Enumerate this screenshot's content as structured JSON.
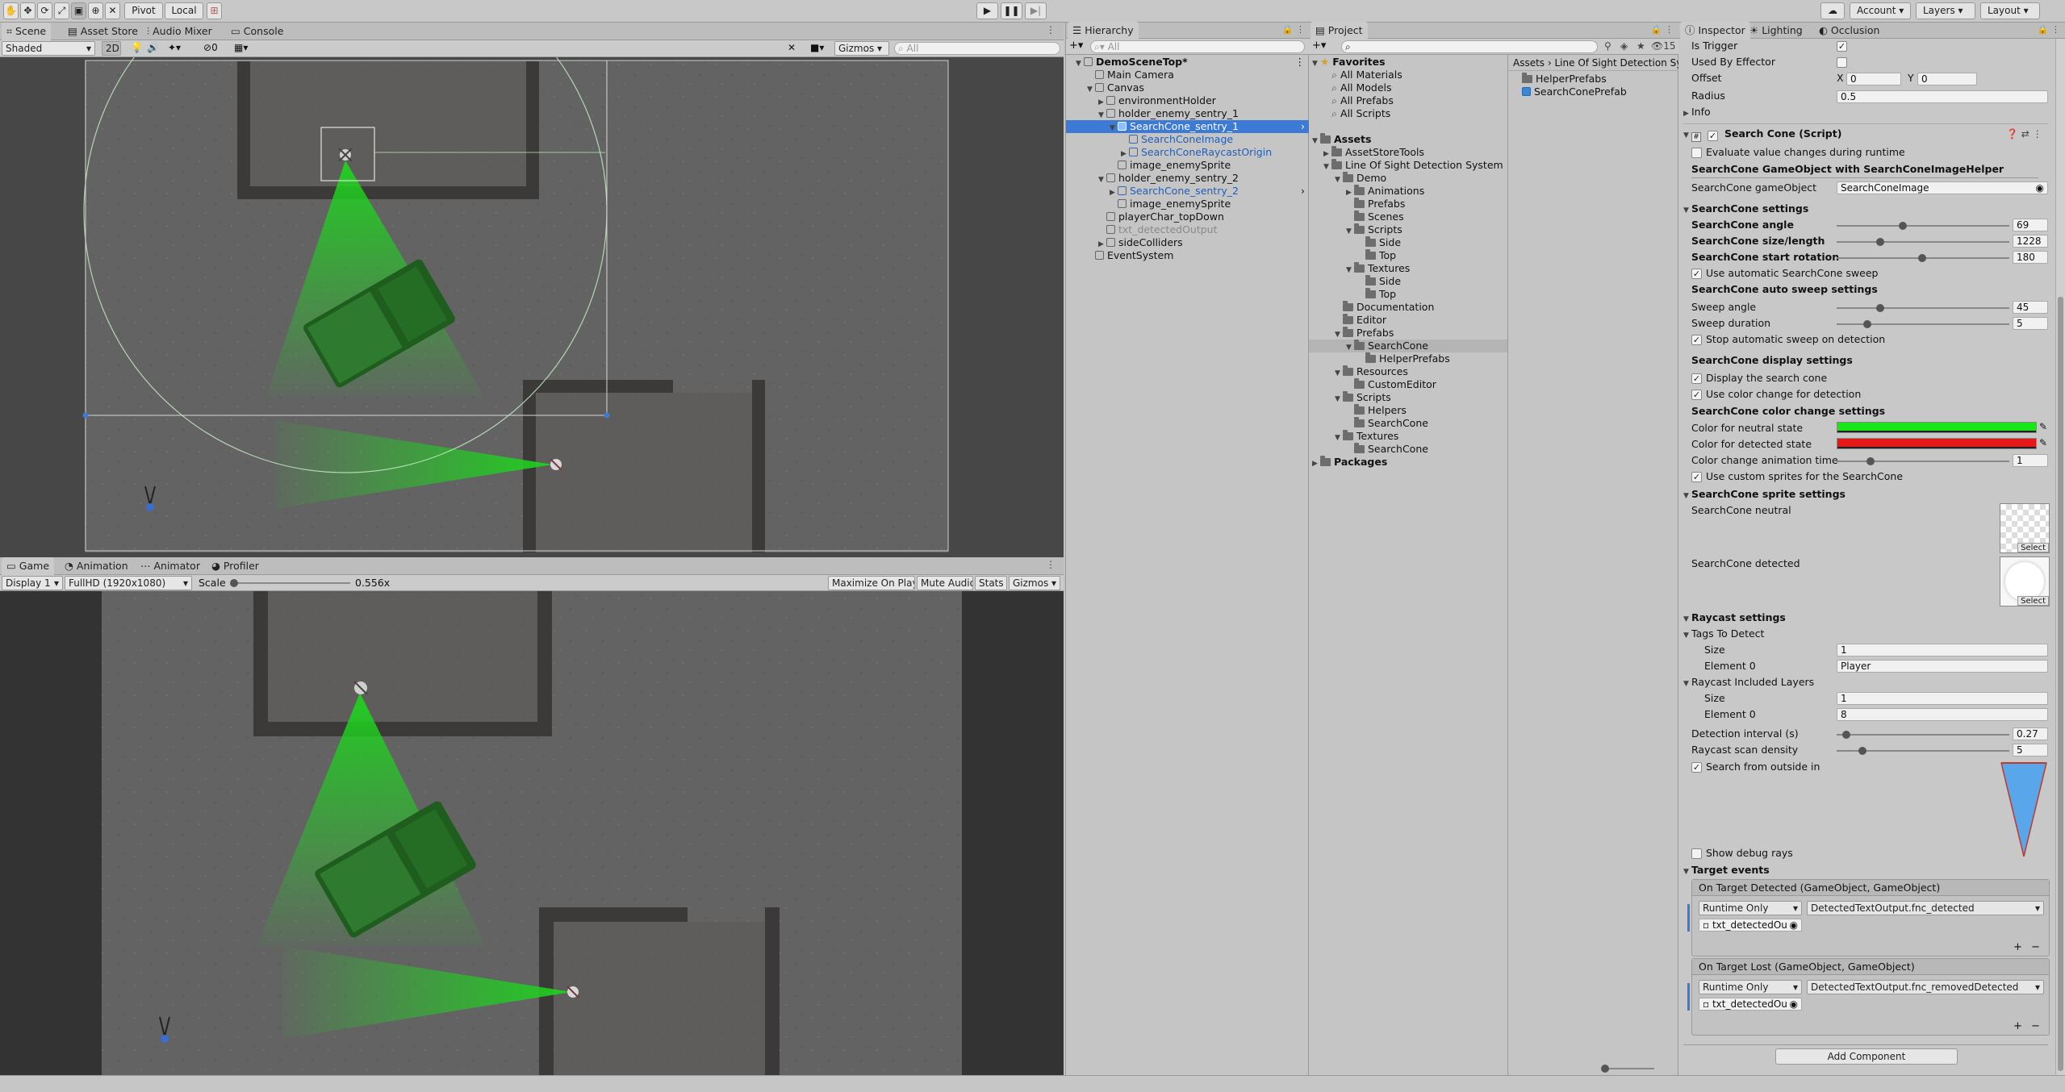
{
  "toolbar": {
    "pivot": "Pivot",
    "local": "Local",
    "account": "Account",
    "layers": "Layers",
    "layout": "Layout"
  },
  "scene": {
    "tabs": [
      "Scene",
      "Asset Store",
      "Audio Mixer",
      "Console"
    ],
    "shading": "Shaded",
    "mode2d": "2D",
    "hidden_count": "0",
    "gizmos": "Gizmos",
    "search_placeholder": "All"
  },
  "game": {
    "tabs": [
      "Game",
      "Animation",
      "Animator",
      "Profiler"
    ],
    "display": "Display 1",
    "resolution": "FullHD (1920x1080)",
    "scale_label": "Scale",
    "scale_value": "0.556x",
    "maximize": "Maximize On Play",
    "mute": "Mute Audio",
    "stats": "Stats",
    "gizmos": "Gizmos"
  },
  "hierarchy": {
    "title": "Hierarchy",
    "search_placeholder": "All",
    "items": [
      {
        "label": "DemoSceneTop*",
        "depth": 0,
        "fold": "open",
        "style": "scene"
      },
      {
        "label": "Main Camera",
        "depth": 1,
        "fold": "none",
        "style": "normal"
      },
      {
        "label": "Canvas",
        "depth": 1,
        "fold": "open",
        "style": "normal"
      },
      {
        "label": "environmentHolder",
        "depth": 2,
        "fold": "closed",
        "style": "normal"
      },
      {
        "label": "holder_enemy_sentry_1",
        "depth": 2,
        "fold": "open",
        "style": "normal"
      },
      {
        "label": "SearchCone_sentry_1",
        "depth": 3,
        "fold": "open",
        "style": "selected"
      },
      {
        "label": "SearchConeImage",
        "depth": 4,
        "fold": "none",
        "style": "prefab"
      },
      {
        "label": "SearchConeRaycastOrigin",
        "depth": 4,
        "fold": "closed",
        "style": "prefab"
      },
      {
        "label": "image_enemySprite",
        "depth": 3,
        "fold": "none",
        "style": "normal"
      },
      {
        "label": "holder_enemy_sentry_2",
        "depth": 2,
        "fold": "open",
        "style": "normal"
      },
      {
        "label": "SearchCone_sentry_2",
        "depth": 3,
        "fold": "closed",
        "style": "prefab"
      },
      {
        "label": "image_enemySprite",
        "depth": 3,
        "fold": "none",
        "style": "normal"
      },
      {
        "label": "playerChar_topDown",
        "depth": 2,
        "fold": "none",
        "style": "normal"
      },
      {
        "label": "txt_detectedOutput",
        "depth": 2,
        "fold": "none",
        "style": "disabled"
      },
      {
        "label": "sideColliders",
        "depth": 2,
        "fold": "closed",
        "style": "normal"
      },
      {
        "label": "EventSystem",
        "depth": 1,
        "fold": "none",
        "style": "normal"
      }
    ]
  },
  "project": {
    "title": "Project",
    "hidden_count": "15",
    "breadcrumb": [
      "Assets",
      "Line Of Sight Detection Sy"
    ],
    "tree": [
      {
        "label": "Favorites",
        "depth": 0,
        "fold": "open",
        "kind": "star",
        "bold": true
      },
      {
        "label": "All Materials",
        "depth": 1,
        "fold": "none",
        "kind": "search",
        "bold": false
      },
      {
        "label": "All Models",
        "depth": 1,
        "fold": "none",
        "kind": "search",
        "bold": false
      },
      {
        "label": "All Prefabs",
        "depth": 1,
        "fold": "none",
        "kind": "search",
        "bold": false
      },
      {
        "label": "All Scripts",
        "depth": 1,
        "fold": "none",
        "kind": "search",
        "bold": false
      },
      {
        "label": "",
        "depth": 0,
        "fold": "none",
        "kind": "gap",
        "bold": false
      },
      {
        "label": "Assets",
        "depth": 0,
        "fold": "open",
        "kind": "folder",
        "bold": true
      },
      {
        "label": "AssetStoreTools",
        "depth": 1,
        "fold": "closed",
        "kind": "folder",
        "bold": false
      },
      {
        "label": "Line Of Sight Detection System",
        "depth": 1,
        "fold": "open",
        "kind": "folder",
        "bold": false
      },
      {
        "label": "Demo",
        "depth": 2,
        "fold": "open",
        "kind": "folder",
        "bold": false
      },
      {
        "label": "Animations",
        "depth": 3,
        "fold": "closed",
        "kind": "folder",
        "bold": false
      },
      {
        "label": "Prefabs",
        "depth": 3,
        "fold": "none",
        "kind": "folder",
        "bold": false
      },
      {
        "label": "Scenes",
        "depth": 3,
        "fold": "none",
        "kind": "folder",
        "bold": false
      },
      {
        "label": "Scripts",
        "depth": 3,
        "fold": "open",
        "kind": "folder",
        "bold": false
      },
      {
        "label": "Side",
        "depth": 4,
        "fold": "none",
        "kind": "folder",
        "bold": false
      },
      {
        "label": "Top",
        "depth": 4,
        "fold": "none",
        "kind": "folder",
        "bold": false
      },
      {
        "label": "Textures",
        "depth": 3,
        "fold": "open",
        "kind": "folder",
        "bold": false
      },
      {
        "label": "Side",
        "depth": 4,
        "fold": "none",
        "kind": "folder",
        "bold": false
      },
      {
        "label": "Top",
        "depth": 4,
        "fold": "none",
        "kind": "folder",
        "bold": false
      },
      {
        "label": "Documentation",
        "depth": 2,
        "fold": "none",
        "kind": "folder",
        "bold": false
      },
      {
        "label": "Editor",
        "depth": 2,
        "fold": "none",
        "kind": "folder",
        "bold": false
      },
      {
        "label": "Prefabs",
        "depth": 2,
        "fold": "open",
        "kind": "folder",
        "bold": false
      },
      {
        "label": "SearchCone",
        "depth": 3,
        "fold": "open",
        "kind": "folder-selected",
        "bold": false
      },
      {
        "label": "HelperPrefabs",
        "depth": 4,
        "fold": "none",
        "kind": "folder",
        "bold": false
      },
      {
        "label": "Resources",
        "depth": 2,
        "fold": "open",
        "kind": "folder",
        "bold": false
      },
      {
        "label": "CustomEditor",
        "depth": 3,
        "fold": "none",
        "kind": "folder",
        "bold": false
      },
      {
        "label": "Scripts",
        "depth": 2,
        "fold": "open",
        "kind": "folder",
        "bold": false
      },
      {
        "label": "Helpers",
        "depth": 3,
        "fold": "none",
        "kind": "folder",
        "bold": false
      },
      {
        "label": "SearchCone",
        "depth": 3,
        "fold": "none",
        "kind": "folder",
        "bold": false
      },
      {
        "label": "Textures",
        "depth": 2,
        "fold": "open",
        "kind": "folder",
        "bold": false
      },
      {
        "label": "SearchCone",
        "depth": 3,
        "fold": "none",
        "kind": "folder",
        "bold": false
      },
      {
        "label": "Packages",
        "depth": 0,
        "fold": "closed",
        "kind": "folder",
        "bold": true
      }
    ],
    "files": [
      {
        "label": "HelperPrefabs",
        "kind": "folder"
      },
      {
        "label": "SearchConePrefab",
        "kind": "prefab"
      }
    ]
  },
  "inspector": {
    "tabs": [
      "Inspector",
      "Lighting",
      "Occlusion"
    ],
    "collider": {
      "is_trigger": "Is Trigger",
      "used_by_effector": "Used By Effector",
      "offset": "Offset",
      "offset_x_label": "X",
      "offset_x": "0",
      "offset_y_label": "Y",
      "offset_y": "0",
      "radius": "Radius",
      "radius_value": "0.5",
      "info": "Info"
    },
    "component_title": "Search Cone (Script)",
    "evaluate_label": "Evaluate value changes during runtime",
    "go_header": "SearchCone GameObject with SearchConeImageHelper",
    "go_label": "SearchCone gameObject",
    "go_value": "SearchConeImage",
    "settings_header": "SearchCone settings",
    "angle_label": "SearchCone angle",
    "angle_value": "69",
    "size_label": "SearchCone size/length",
    "size_value": "1228",
    "rotation_label": "SearchCone start rotation",
    "rotation_value": "180",
    "auto_sweep_label": "Use automatic SearchCone sweep",
    "sweep_header": "SearchCone auto sweep settings",
    "sweep_angle_label": "Sweep angle",
    "sweep_angle_value": "45",
    "sweep_duration_label": "Sweep duration",
    "sweep_duration_value": "5",
    "stop_sweep_label": "Stop automatic sweep on detection",
    "display_header": "SearchCone display settings",
    "display_cone_label": "Display the search cone",
    "use_color_label": "Use color change for detection",
    "color_header": "SearchCone color change settings",
    "neutral_label": "Color for neutral state",
    "neutral_color": "#19e619",
    "detected_label": "Color for detected state",
    "detected_color": "#e61919",
    "color_time_label": "Color change animation time",
    "color_time_value": "1",
    "custom_sprites_label": "Use custom sprites for the SearchCone",
    "sprite_header": "SearchCone sprite settings",
    "sprite_neutral": "SearchCone neutral",
    "sprite_detected": "SearchCone detected",
    "select": "Select",
    "raycast_header": "Raycast settings",
    "tags_label": "Tags To Detect",
    "size_l": "Size",
    "tags_size": "1",
    "element0": "Element 0",
    "tags_element0": "Player",
    "layers_label": "Raycast Included Layers",
    "layers_size": "1",
    "layers_element0": "8",
    "interval_label": "Detection interval (s)",
    "interval_value": "0.27",
    "density_label": "Raycast scan density",
    "density_value": "5",
    "search_outside_label": "Search from outside in",
    "debug_rays_label": "Show debug rays",
    "events_header": "Target events",
    "event1_title": "On Target Detected (GameObject, GameObject)",
    "event1_mode": "Runtime Only",
    "event1_func": "DetectedTextOutput.fnc_detected",
    "event1_obj": "txt_detectedOu",
    "event2_title": "On Target Lost (GameObject, GameObject)",
    "event2_mode": "Runtime Only",
    "event2_func": "DetectedTextOutput.fnc_removedDetected",
    "event2_obj": "txt_detectedOu",
    "add_component": "Add Component"
  }
}
